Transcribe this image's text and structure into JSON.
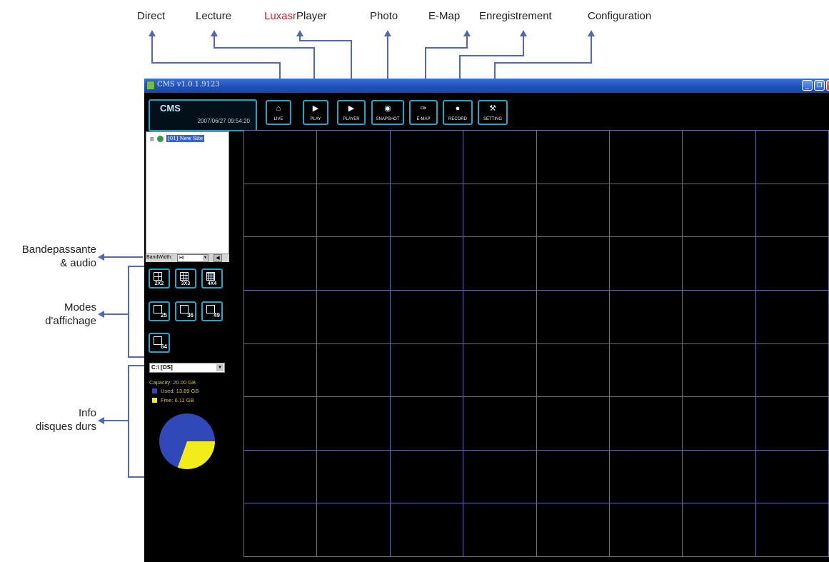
{
  "annotations": {
    "top": [
      {
        "id": "direct",
        "text": "Direct"
      },
      {
        "id": "lecture",
        "text": "Lecture"
      },
      {
        "id": "player",
        "brand": "Luxasr",
        "text": "Player"
      },
      {
        "id": "photo",
        "text": "Photo"
      },
      {
        "id": "emap",
        "text": "E-Map"
      },
      {
        "id": "enregistrement",
        "text": "Enregistrement"
      },
      {
        "id": "configuration",
        "text": "Configuration"
      }
    ],
    "side": {
      "bandwidth": {
        "line1": "Bandepassante",
        "line2": "& audio"
      },
      "display_modes": {
        "line1": "Modes",
        "line2": "d'affichage"
      },
      "disk_info": {
        "line1": "Info",
        "line2": "disques durs"
      }
    }
  },
  "window": {
    "title": "CMS  v1.0.1.9123",
    "logo": "CMS",
    "clock": "2007/06/27 09:54:20"
  },
  "toolbar": [
    {
      "label": "LIVE",
      "icon": "⌂"
    },
    {
      "label": "PLAY",
      "icon": "▶"
    },
    {
      "label": "PLAYER",
      "icon": "▶"
    },
    {
      "label": "SNAPSHOT",
      "icon": "◉"
    },
    {
      "label": "E-MAP",
      "icon": "✑"
    },
    {
      "label": "RECORD",
      "icon": "●"
    },
    {
      "label": "SETTING",
      "icon": "⚒"
    }
  ],
  "tree": {
    "expander": "⊞",
    "node_label": "[01] New Site"
  },
  "bandwidth": {
    "label": "BandWidth:",
    "value": "HI",
    "audio_icon": "◀"
  },
  "display_modes": [
    {
      "label": "2X2",
      "icon": "grid-2x2-icon"
    },
    {
      "label": "3X3",
      "icon": "grid-3x3-icon"
    },
    {
      "label": "4X4",
      "icon": "grid-4x4-icon"
    },
    {
      "label": "25",
      "icon": "layout-25-icon"
    },
    {
      "label": "36",
      "icon": "layout-36-icon"
    },
    {
      "label": "49",
      "icon": "layout-49-icon"
    },
    {
      "label": "64",
      "icon": "layout-64-icon"
    }
  ],
  "disk": {
    "selected": "C:\\ [OS]",
    "capacity": "Capacity: 20.00 GB",
    "used_label": "Used: 13.89 GB",
    "free_label": "Free: 6.11 GB",
    "used_gb": 13.89,
    "free_gb": 6.11,
    "used_color": "#3048b8",
    "free_color": "#f2ec1a"
  },
  "video_grid": {
    "rows": 8,
    "cols": 8
  }
}
